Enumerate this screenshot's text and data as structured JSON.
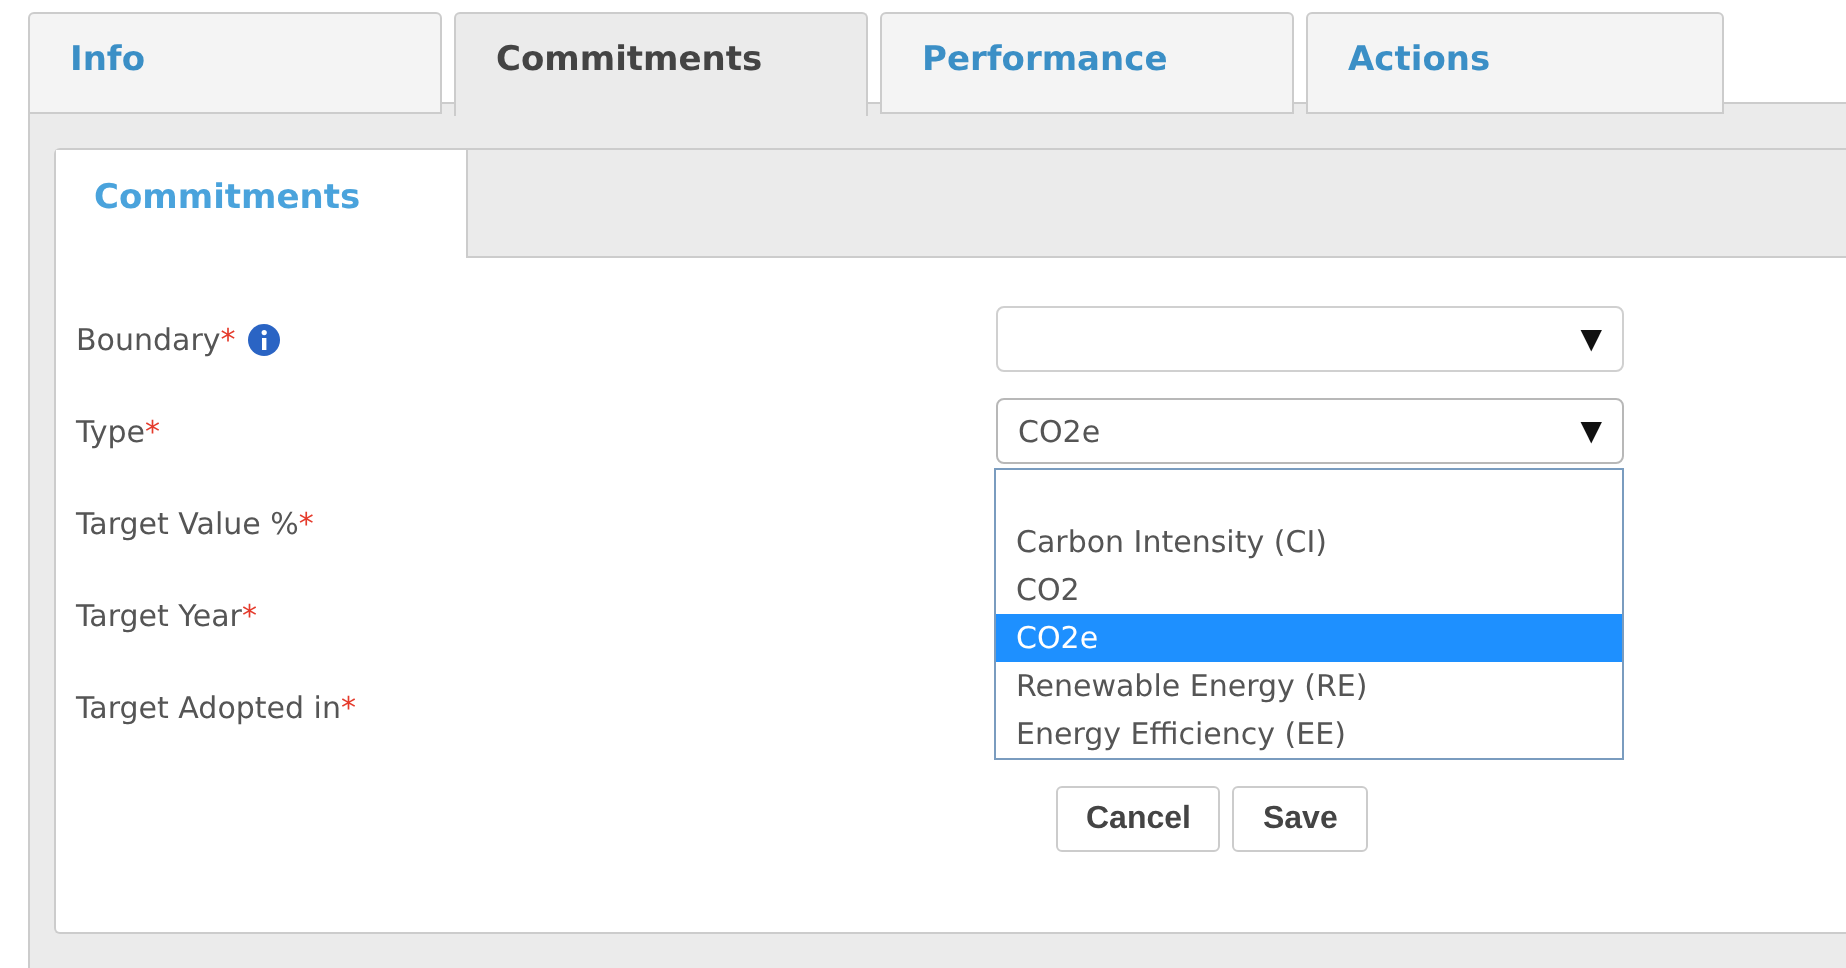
{
  "tabs": [
    {
      "label": "Info",
      "selected": false
    },
    {
      "label": "Commitments",
      "selected": true
    },
    {
      "label": "Performance",
      "selected": false
    },
    {
      "label": "Actions",
      "selected": false
    }
  ],
  "subtabs": [
    {
      "label": "Commitments",
      "selected": true
    }
  ],
  "fields": [
    {
      "label": "Boundary",
      "mark": "*",
      "info": true,
      "kind": "select",
      "caret": "▼"
    },
    {
      "label": "Type",
      "mark": "*",
      "kind": "select",
      "value": "CO2e",
      "caret": "▼",
      "open": true
    },
    {
      "label": "Target Value %",
      "mark": "*",
      "kind": "covered"
    },
    {
      "label": "Target Year",
      "mark": "*",
      "kind": "covered"
    },
    {
      "label": "Target Adopted in",
      "mark": "*",
      "kind": "covered"
    }
  ],
  "dropdown": {
    "options": [
      {
        "label": "Carbon Intensity (CI)",
        "selected": false
      },
      {
        "label": "CO2",
        "selected": false
      },
      {
        "label": "CO2e",
        "selected": true
      },
      {
        "label": "Renewable Energy (RE)",
        "selected": false
      },
      {
        "label": "Energy Efficiency (EE)",
        "selected": false
      }
    ]
  },
  "buttons": [
    {
      "label": "Cancel"
    },
    {
      "label": "Save"
    }
  ]
}
